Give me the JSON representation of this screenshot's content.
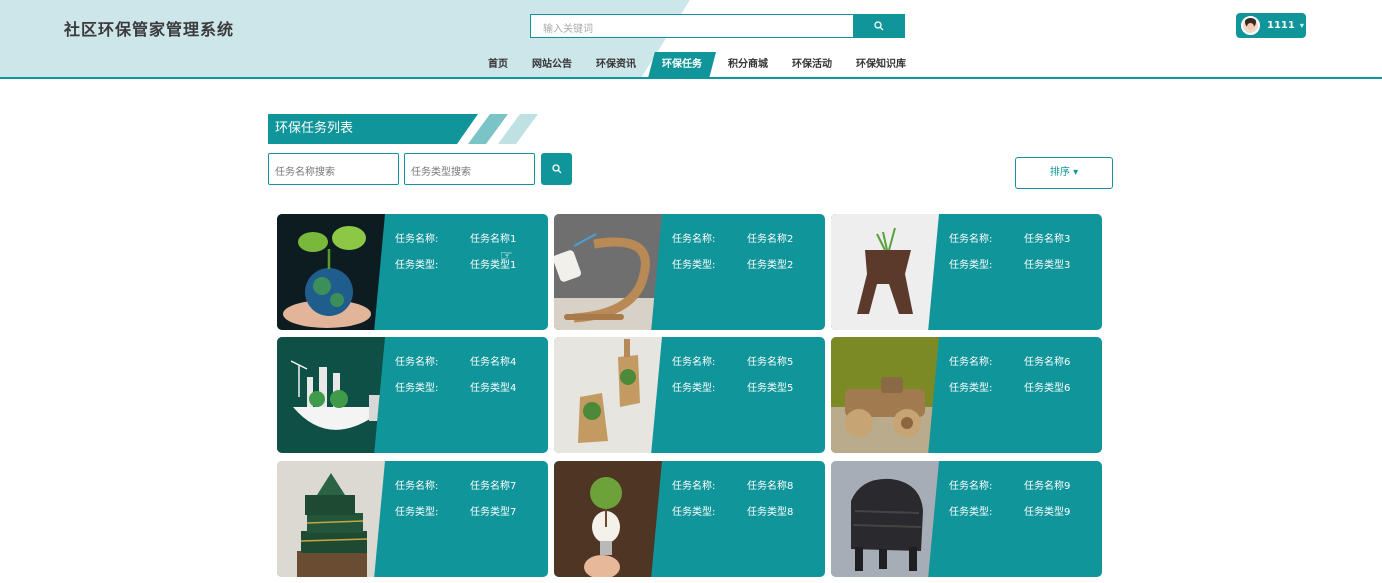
{
  "header": {
    "site_title": "社区环保管家管理系统",
    "search_placeholder": "输入关键词",
    "search_icon": "search-icon",
    "user_name": "1111",
    "user_caret": "▾"
  },
  "nav": {
    "items": [
      {
        "label": "首页",
        "active": false
      },
      {
        "label": "网站公告",
        "active": false
      },
      {
        "label": "环保资讯",
        "active": false
      },
      {
        "label": "环保任务",
        "active": true
      },
      {
        "label": "积分商城",
        "active": false
      },
      {
        "label": "环保活动",
        "active": false
      },
      {
        "label": "环保知识库",
        "active": false
      }
    ]
  },
  "section": {
    "title": "环保任务列表",
    "name_search_placeholder": "任务名称搜索",
    "type_search_placeholder": "任务类型搜索",
    "sort_label": "排序 ▾"
  },
  "card_labels": {
    "name_key": "任务名称:",
    "type_key": "任务类型:"
  },
  "tasks": [
    {
      "name": "任务名称1",
      "type": "任务类型1",
      "image": "earth-in-hands-sprout"
    },
    {
      "name": "任务名称2",
      "type": "任务类型2",
      "image": "wooden-lamp"
    },
    {
      "name": "任务名称3",
      "type": "任务类型3",
      "image": "cardboard-plant-stand"
    },
    {
      "name": "任务名称4",
      "type": "任务类型4",
      "image": "green-city-lightbulb"
    },
    {
      "name": "任务名称5",
      "type": "任务类型5",
      "image": "cardboard-plant-pockets"
    },
    {
      "name": "任务名称6",
      "type": "任务类型6",
      "image": "cardboard-car"
    },
    {
      "name": "任务名称7",
      "type": "任务类型7",
      "image": "green-gift-boxes"
    },
    {
      "name": "任务名称8",
      "type": "任务类型8",
      "image": "bulb-with-tree"
    },
    {
      "name": "任务名称9",
      "type": "任务类型9",
      "image": "recycled-chair"
    }
  ],
  "colors": {
    "accent": "#10959a",
    "header_bg": "#cde6ea"
  }
}
